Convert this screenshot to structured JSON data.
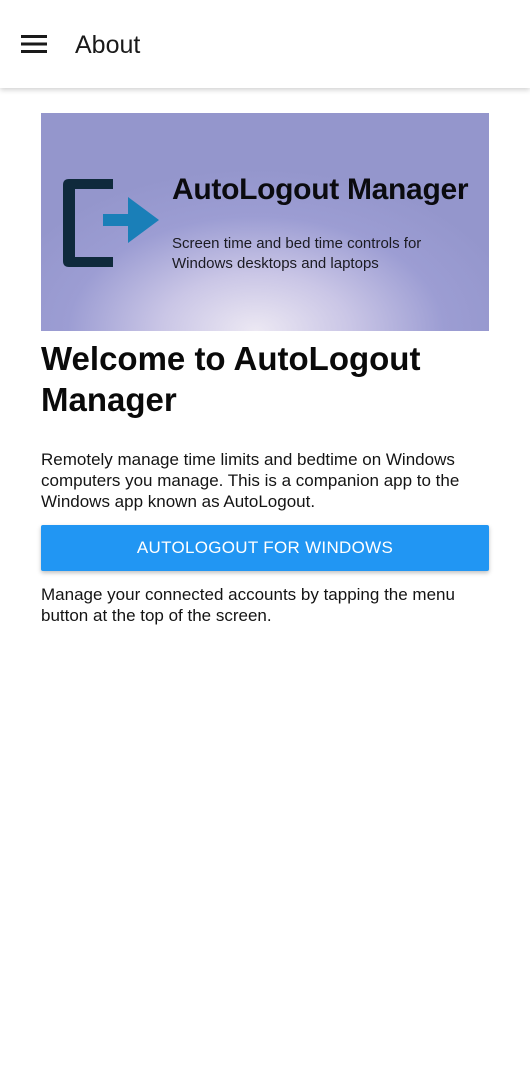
{
  "appbar": {
    "menu_icon": "hamburger-menu-icon",
    "title": "About"
  },
  "banner": {
    "logo_icon": "logout-arrow-icon",
    "title": "AutoLogout Manager",
    "subtitle": "Screen time and bed time controls for Windows desktops and laptops",
    "colors": {
      "background": "#9496cc",
      "logo_bracket": "#0f2a3c",
      "logo_arrow": "#1a7fb8"
    }
  },
  "main": {
    "heading": "Welcome to AutoLogout Manager",
    "description": "Remotely manage time limits and bedtime on Windows computers you manage. This is a companion app to the Windows app known as AutoLogout.",
    "windows_button_label": "AUTOLOGOUT FOR WINDOWS",
    "manage_text": "Manage your connected accounts by tapping the menu button at the top of the screen."
  },
  "colors": {
    "primary_button": "#2196f3"
  }
}
